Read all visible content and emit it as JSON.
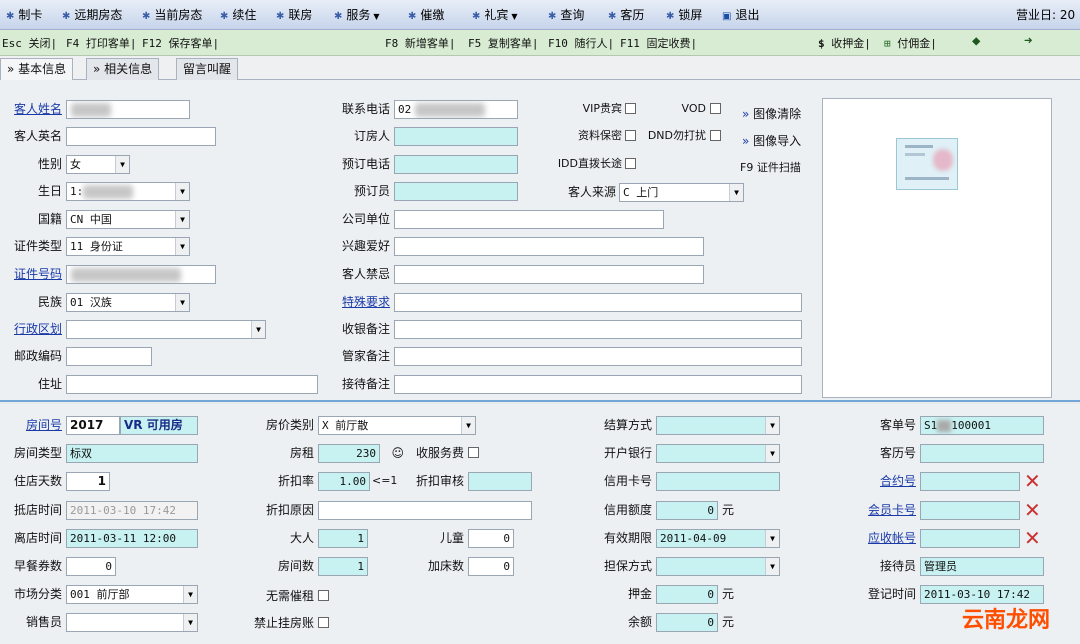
{
  "menu": {
    "items": [
      "制卡",
      "远期房态",
      "当前房态",
      "续住",
      "联房",
      "服务",
      "催缴",
      "礼宾",
      "查询",
      "客历",
      "锁屏",
      "退出"
    ],
    "business_day_label": "营业日: 20"
  },
  "toolbar": {
    "esc": "Esc 关闭|",
    "f4": "F4 打印客单|",
    "f12": "F12 保存客单|",
    "f8": "F8 新增客单|",
    "f5": "F5 复制客单|",
    "f10": "F10 随行人|",
    "f11": "F11 固定收费|",
    "deposit": "收押金|",
    "commission": "付佣金|"
  },
  "tabs": [
    "基本信息",
    "相关信息",
    "留言叫醒"
  ],
  "guest": {
    "name_label": "客人姓名",
    "en_name_label": "客人英名",
    "gender_label": "性别",
    "gender": "女",
    "birthday_label": "生日",
    "birthday_prefix": "1:",
    "nationality_label": "国籍",
    "nationality": "CN 中国",
    "id_type_label": "证件类型",
    "id_type": "11 身份证",
    "id_no_label": "证件号码",
    "ethnic_label": "民族",
    "ethnic": "01 汉族",
    "region_label": "行政区划",
    "postcode_label": "邮政编码",
    "address_label": "住址",
    "phone_label": "联系电话",
    "phone_prefix": "02",
    "booker_label": "订房人",
    "booking_phone_label": "预订电话",
    "reservation_staff_label": "预订员",
    "company_label": "公司单位",
    "hobby_label": "兴趣爱好",
    "taboo_label": "客人禁忌",
    "special_label": "特殊要求",
    "cashier_note_label": "收银备注",
    "housekeeping_note_label": "管家备注",
    "reception_note_label": "接待备注",
    "vip_label": "VIP贵宾",
    "vod_label": "VOD",
    "privacy_label": "资料保密",
    "dnd_label": "DND勿打扰",
    "idd_label": "IDD直拨长途",
    "source_label": "客人来源",
    "source": "C 上门",
    "img_clear": "图像清除",
    "img_import": "图像导入",
    "scan": "F9 证件扫描"
  },
  "room": {
    "room_no_label": "房间号",
    "room_no": "2017",
    "room_status": "VR 可用房",
    "room_type_label": "房间类型",
    "room_type": "标双",
    "days_label": "住店天数",
    "days": "1",
    "arrival_label": "抵店时间",
    "arrival": "2011-03-10 17:42",
    "departure_label": "离店时间",
    "departure": "2011-03-11 12:00",
    "breakfast_label": "早餐券数",
    "breakfast": "0",
    "market_label": "市场分类",
    "market": "001 前厅部",
    "sales_label": "销售员",
    "price_type_label": "房价类别",
    "price_type": "X 前厅散",
    "rent_label": "房租",
    "rent": "230",
    "service_fee_label": "收服务费",
    "discount_rate_label": "折扣率",
    "discount_rate": "1.00",
    "discount_hint": "<=1",
    "discount_audit_label": "折扣审核",
    "discount_reason_label": "折扣原因",
    "adults_label": "大人",
    "adults": "1",
    "children_label": "儿童",
    "children": "0",
    "rooms_label": "房间数",
    "rooms": "1",
    "extra_bed_label": "加床数",
    "extra_bed": "0",
    "no_remind_label": "无需催租",
    "no_charge_label": "禁止挂房账",
    "settle_label": "结算方式",
    "bank_label": "开户银行",
    "card_no_label": "信用卡号",
    "credit_limit_label": "信用额度",
    "credit_limit": "0",
    "yuan": "元",
    "expiry_label": "有效期限",
    "expiry": "2011-04-09",
    "guarantee_label": "担保方式",
    "deposit_label": "押金",
    "deposit": "0",
    "balance_label": "余额",
    "balance": "0",
    "order_no_label": "客单号",
    "order_no_prefix": "S1",
    "order_no_suffix": "100001",
    "history_label": "客历号",
    "contract_label": "合约号",
    "member_label": "会员卡号",
    "ar_label": "应收帐号",
    "receptionist_label": "接待员",
    "receptionist": "管理员",
    "register_label": "登记时间",
    "register": "2011-03-10 17:42"
  },
  "watermark": "云南龙网"
}
